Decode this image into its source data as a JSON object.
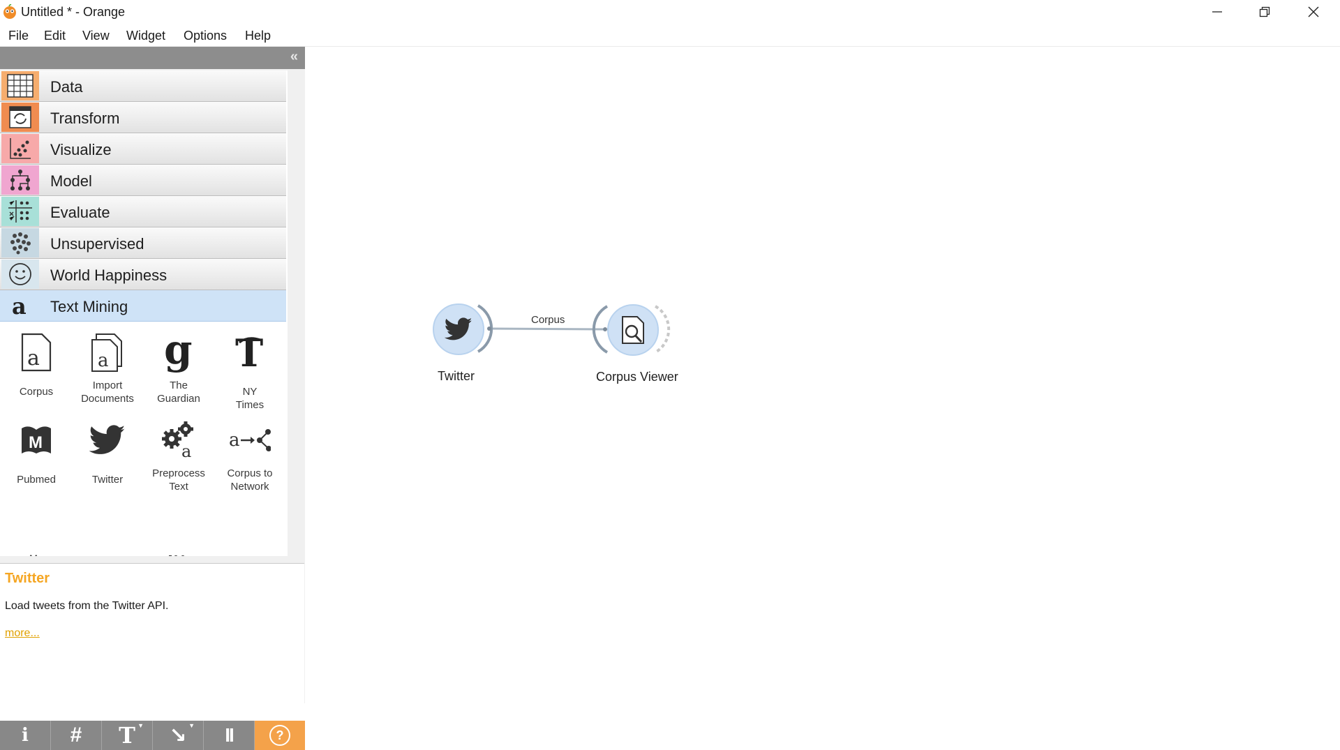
{
  "window": {
    "title": "Untitled * - Orange"
  },
  "menu": [
    "File",
    "Edit",
    "View",
    "Widget",
    "Options",
    "Help"
  ],
  "toolbox": {
    "collapse_glyph": "«",
    "categories": [
      {
        "label": "Data",
        "icon": "table-icon",
        "color": "#f6ad6e"
      },
      {
        "label": "Transform",
        "icon": "transform-icon",
        "color": "#f08c50"
      },
      {
        "label": "Visualize",
        "icon": "scatter-icon",
        "color": "#f7a9a9"
      },
      {
        "label": "Model",
        "icon": "tree-icon",
        "color": "#f0a6d0"
      },
      {
        "label": "Evaluate",
        "icon": "evaluate-icon",
        "color": "#a8e0d8"
      },
      {
        "label": "Unsupervised",
        "icon": "cluster-icon",
        "color": "#c6d8e2"
      },
      {
        "label": "World Happiness",
        "icon": "smiley-icon",
        "color": "#d8e6ee"
      },
      {
        "label": "Text Mining",
        "icon": "text-a-icon",
        "color": "#cfe3f7"
      }
    ],
    "widgets": [
      {
        "label": "Corpus",
        "icon": "corpus-icon"
      },
      {
        "label": "Import Documents",
        "icon": "import-documents-icon"
      },
      {
        "label": "The Guardian",
        "icon": "guardian-icon"
      },
      {
        "label": "NY Times",
        "icon": "nytimes-icon"
      },
      {
        "label": "Pubmed",
        "icon": "pubmed-icon"
      },
      {
        "label": "Twitter",
        "icon": "twitter-bird-icon"
      },
      {
        "label": "Preprocess Text",
        "icon": "preprocess-gears-icon"
      },
      {
        "label": "Corpus to Network",
        "icon": "corpus-to-network-icon"
      }
    ]
  },
  "description": {
    "title": "Twitter",
    "text": "Load tweets from the Twitter API.",
    "more": "more..."
  },
  "bottom_toolbar": [
    {
      "glyph": "i",
      "icon": "info-icon"
    },
    {
      "glyph": "#",
      "icon": "grid-icon"
    },
    {
      "glyph": "T",
      "icon": "text-annotation-icon"
    },
    {
      "glyph": "↘",
      "icon": "arrow-annotation-icon"
    },
    {
      "glyph": "II",
      "icon": "pause-icon"
    },
    {
      "glyph": "?",
      "icon": "help-icon"
    }
  ],
  "canvas": {
    "nodes": [
      {
        "label": "Twitter",
        "icon": "twitter-bird-icon"
      },
      {
        "label": "Corpus Viewer",
        "icon": "corpus-viewer-icon"
      }
    ],
    "link_label": "Corpus"
  },
  "colors": {
    "accent_orange": "#f5a623",
    "node_fill": "#cfe1f5",
    "dock_header": "#8d8d8d"
  }
}
